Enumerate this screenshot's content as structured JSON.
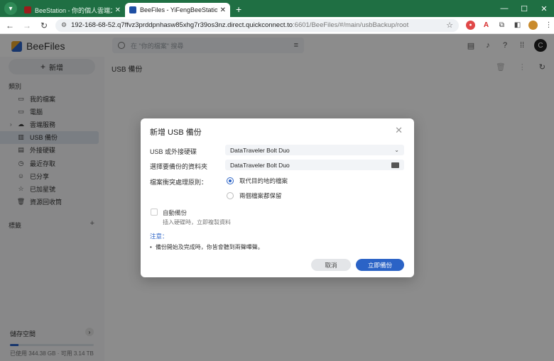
{
  "browser": {
    "tabs": [
      {
        "label": "BeeStation - 你的個人雲端之旅",
        "active": false
      },
      {
        "label": "BeeFiles - YiFengBeeStation",
        "active": true
      }
    ],
    "url_host": "192-168-68-52.q7ffvz3prddpnhasw85xhg7r39os3nz.direct.quickconnect.to",
    "url_path": ":6601/BeeFiles/#/main/usbBackup/root",
    "window_controls": {
      "minimize": "—",
      "maximize": "☐",
      "close": "✕"
    }
  },
  "app": {
    "name": "BeeFiles",
    "search_placeholder": "在 \"你的檔案\" 搜尋",
    "avatar_letter": "C"
  },
  "sidebar": {
    "new_label": "新增",
    "category_title": "類別",
    "items": [
      {
        "label": "我的檔案",
        "icon": "folder-icon"
      },
      {
        "label": "電腦",
        "icon": "monitor-icon"
      },
      {
        "label": "雲端服務",
        "icon": "cloud-icon"
      },
      {
        "label": "USB 備份",
        "icon": "usb-drive-icon"
      },
      {
        "label": "外接硬碟",
        "icon": "external-drive-icon"
      },
      {
        "label": "最近存取",
        "icon": "clock-icon"
      },
      {
        "label": "已分享",
        "icon": "people-icon"
      },
      {
        "label": "已加星號",
        "icon": "star-icon"
      },
      {
        "label": "資源回收筒",
        "icon": "trash-icon"
      }
    ],
    "active_index": 3,
    "tags_title": "標籤",
    "storage": {
      "title": "儲存空間",
      "used": "已使用 344.38 GB",
      "available": "可用 3.14 TB",
      "used_fraction": 0.1
    }
  },
  "main": {
    "title": "USB 備份"
  },
  "dialog": {
    "title": "新增 USB 備份",
    "usb_label": "USB 或外接硬碟",
    "usb_value": "DataTraveler Bolt Duo",
    "folder_label": "選擇要備份的資料夾",
    "folder_value": "DataTraveler Bolt Duo",
    "conflict_label": "檔案衝突處理原則：",
    "option_replace": "取代目的地的檔案",
    "option_keep": "兩個檔案都保留",
    "auto_label": "自動備份",
    "auto_desc": "插入硬碟時，立即複製資料",
    "note_title": "注意：",
    "note_text": "備份開始及完成時，你皆會聽到兩聲嗶聲。",
    "cancel_label": "取消",
    "ok_label": "立即備份"
  },
  "colors": {
    "chrome_green": "#1f6f43",
    "accent_blue": "#2b63c6"
  }
}
